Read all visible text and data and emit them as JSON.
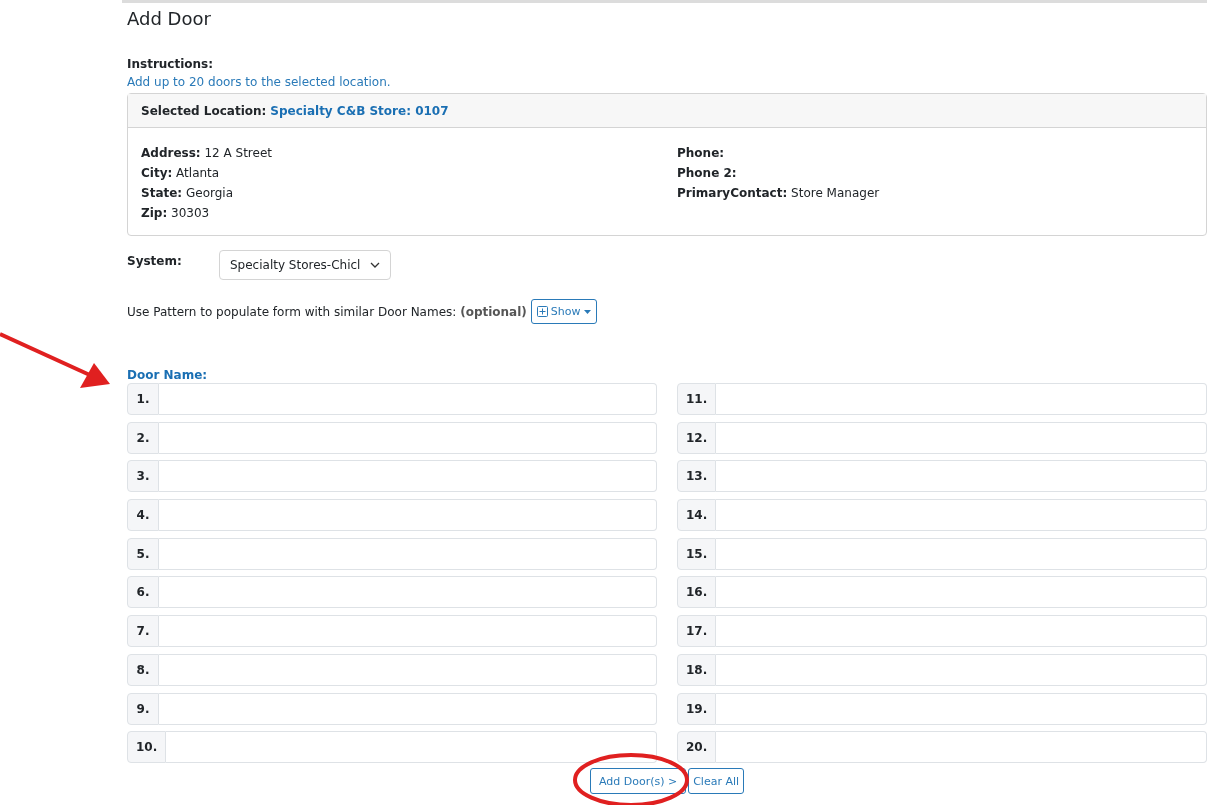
{
  "page_title": "Add Door",
  "instructions": {
    "label": "Instructions:",
    "text": "Add up to 20 doors to the selected location."
  },
  "location": {
    "label": "Selected Location:",
    "name": "Specialty C&B Store: 0107",
    "left_fields": [
      {
        "label": "Address:",
        "value": "12 A Street"
      },
      {
        "label": "City:",
        "value": "Atlanta"
      },
      {
        "label": "State:",
        "value": "Georgia"
      },
      {
        "label": "Zip:",
        "value": "30303"
      }
    ],
    "right_fields": [
      {
        "label": "Phone:"
      },
      {
        "label": "Phone 2:"
      },
      {
        "label": "PrimaryContact:",
        "value": "Store Manager"
      }
    ]
  },
  "system": {
    "label": "System:",
    "value": "Specialty Stores-Chicl"
  },
  "pattern": {
    "text": "Use Pattern to populate form with similar Door Names: **(optional)**",
    "button": "Show"
  },
  "door_name_label": "Door Name:",
  "doors": [
    {
      "number": "1."
    },
    {
      "number": "2."
    },
    {
      "number": "3."
    },
    {
      "number": "4."
    },
    {
      "number": "5."
    },
    {
      "number": "6."
    },
    {
      "number": "7."
    },
    {
      "number": "8."
    },
    {
      "number": "9."
    },
    {
      "number": "10."
    },
    {
      "number": "11."
    },
    {
      "number": "12."
    },
    {
      "number": "13."
    },
    {
      "number": "14."
    },
    {
      "number": "15."
    },
    {
      "number": "16."
    },
    {
      "number": "17."
    },
    {
      "number": "18."
    },
    {
      "number": "19."
    },
    {
      "number": "20."
    }
  ],
  "buttons": [
    {
      "label": "Add Door(s) >",
      "kind": "primary"
    },
    {
      "label": "Clear All",
      "kind": "secondary"
    }
  ]
}
